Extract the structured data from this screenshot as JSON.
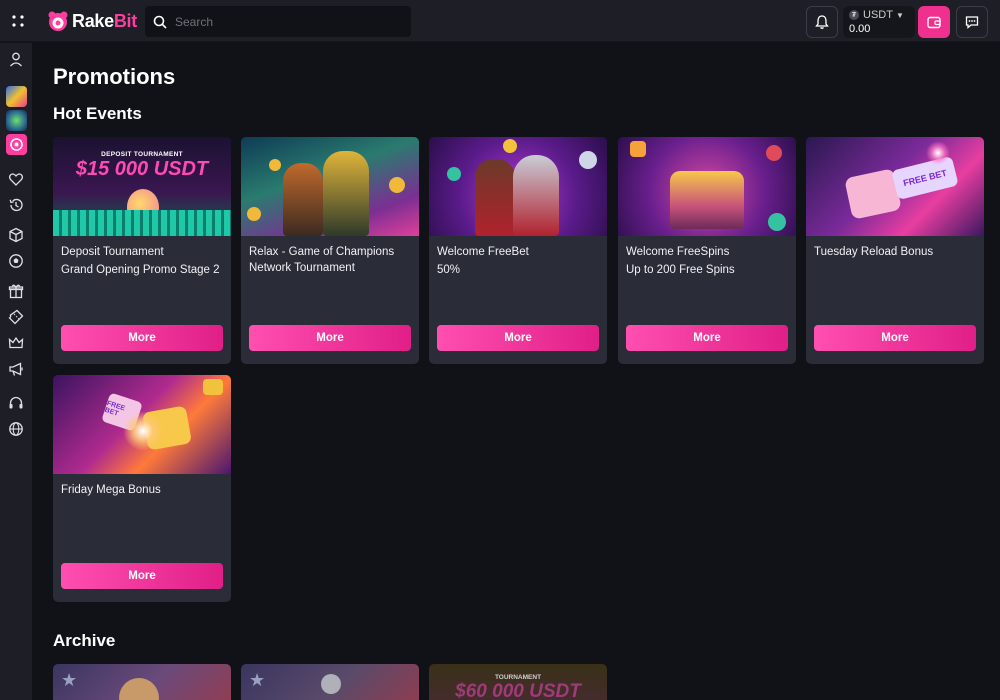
{
  "header": {
    "brand_main": "Rake",
    "brand_accent": "Bit",
    "search_placeholder": "Search",
    "currency": "USDT",
    "balance": "0.00"
  },
  "page": {
    "title": "Promotions",
    "hot_events_title": "Hot Events",
    "archive_title": "Archive"
  },
  "promotions": [
    {
      "title": "Deposit Tournament",
      "subtitle": "Grand Opening Promo Stage 2",
      "banner_caption": "DEPOSIT TOURNAMENT",
      "banner_headline": "$15 000 USDT",
      "button": "More"
    },
    {
      "title": "Relax - Game of Champions Network Tournament",
      "subtitle": "",
      "button": "More"
    },
    {
      "title": "Welcome FreeBet",
      "subtitle": "50%",
      "button": "More"
    },
    {
      "title": "Welcome FreeSpins",
      "subtitle": "Up to 200 Free Spins",
      "button": "More"
    },
    {
      "title": "Tuesday Reload Bonus",
      "subtitle": "",
      "banner_ticket": "FREE BET",
      "button": "More"
    },
    {
      "title": "Friday Mega Bonus",
      "subtitle": "",
      "banner_ticket": "FREE BET",
      "button": "More"
    }
  ],
  "archive": [
    {
      "banner_caption": ""
    },
    {
      "banner_caption": ""
    },
    {
      "banner_caption": "TOURNAMENT",
      "banner_headline": "$60 000 USDT"
    }
  ],
  "colors": {
    "accent": "#f0308f",
    "background": "#111217",
    "panel": "#1e1f26",
    "card": "#2a2c37"
  },
  "icons": {
    "sidebar": [
      "user-icon",
      "game-rainbow-icon",
      "game-planet-icon",
      "game-wheel-icon",
      "heart-icon",
      "history-icon",
      "casino-dice-icon",
      "soccer-ball-icon",
      "gift-icon",
      "ticket-icon",
      "crown-icon",
      "megaphone-icon",
      "headset-icon",
      "globe-icon"
    ]
  }
}
